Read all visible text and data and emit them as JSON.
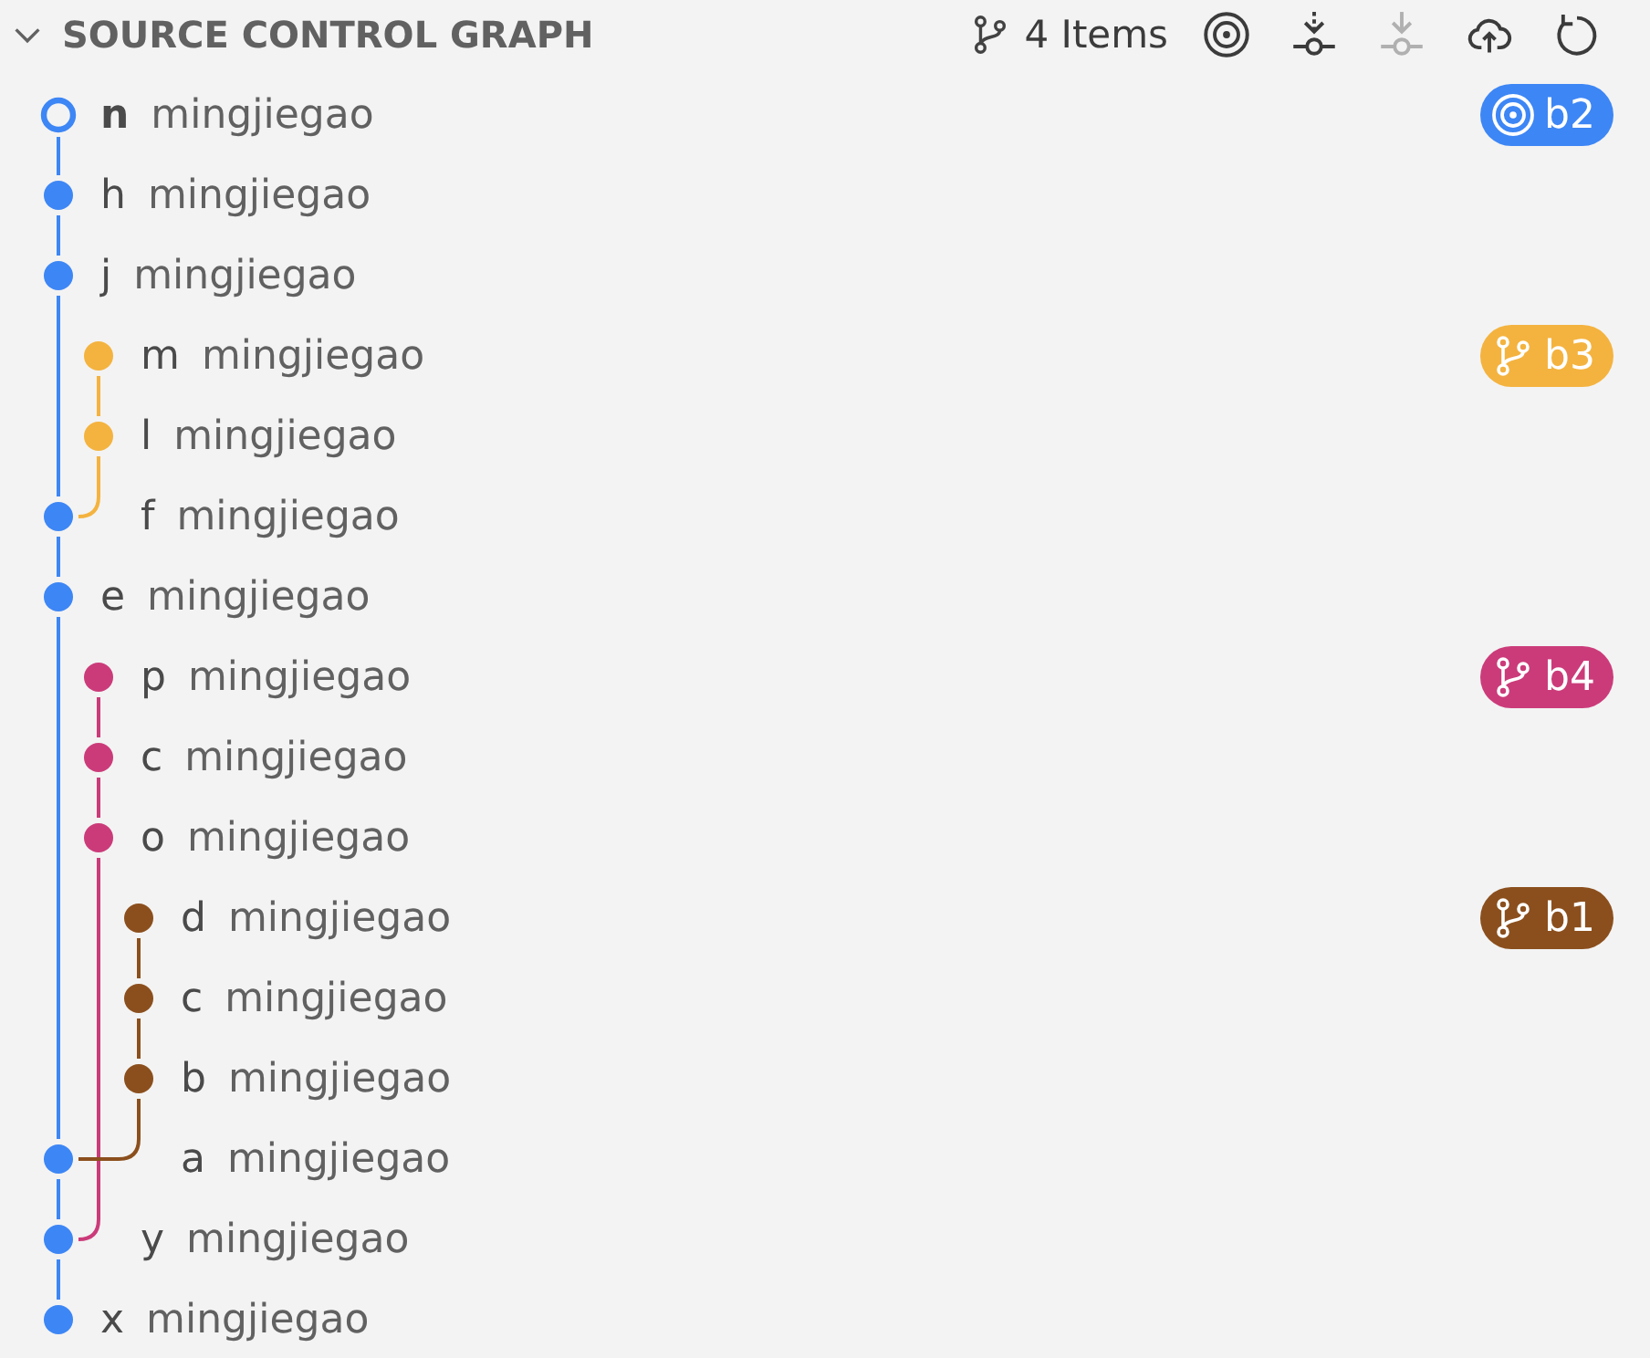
{
  "header": {
    "title": "SOURCE CONTROL GRAPH",
    "expanded": true,
    "count": "4 Items",
    "actions": [
      {
        "kind": "target",
        "disabled": false
      },
      {
        "kind": "fetch",
        "disabled": false
      },
      {
        "kind": "pull",
        "disabled": true
      },
      {
        "kind": "push",
        "disabled": false
      },
      {
        "kind": "refresh",
        "disabled": false
      }
    ]
  },
  "commits": [
    {
      "message": "n",
      "author": "mingjiegao",
      "graph": [
        {
          "kind": "head",
          "color": "#3d86f5"
        }
      ],
      "ref": {
        "label": "b2",
        "kind": "current",
        "color": "#3d86f5"
      }
    },
    {
      "message": "h",
      "author": "mingjiegao",
      "graph": [
        {
          "kind": "node",
          "color": "#3d86f5"
        }
      ]
    },
    {
      "message": "j",
      "author": "mingjiegao",
      "graph": [
        {
          "kind": "node",
          "color": "#3d86f5"
        }
      ]
    },
    {
      "message": "m",
      "author": "mingjiegao",
      "graph": [
        {
          "kind": "line",
          "color": "#3d86f5"
        },
        {
          "kind": "tip",
          "color": "#f4b33f"
        }
      ],
      "ref": {
        "label": "b3",
        "kind": "branch",
        "color": "#f4b33f"
      }
    },
    {
      "message": "l",
      "author": "mingjiegao",
      "graph": [
        {
          "kind": "line",
          "color": "#3d86f5"
        },
        {
          "kind": "node",
          "color": "#f4b33f"
        }
      ]
    },
    {
      "message": "f",
      "author": "mingjiegao",
      "graph": [
        {
          "kind": "node",
          "color": "#3d86f5"
        },
        {
          "kind": "merge",
          "color": "#f4b33f"
        }
      ]
    },
    {
      "message": "e",
      "author": "mingjiegao",
      "graph": [
        {
          "kind": "node",
          "color": "#3d86f5"
        }
      ]
    },
    {
      "message": "p",
      "author": "mingjiegao",
      "graph": [
        {
          "kind": "line",
          "color": "#3d86f5"
        },
        {
          "kind": "tip",
          "color": "#cb3b7a"
        }
      ],
      "ref": {
        "label": "b4",
        "kind": "branch",
        "color": "#cb3b7a"
      }
    },
    {
      "message": "c",
      "author": "mingjiegao",
      "graph": [
        {
          "kind": "line",
          "color": "#3d86f5"
        },
        {
          "kind": "node",
          "color": "#cb3b7a"
        }
      ]
    },
    {
      "message": "o",
      "author": "mingjiegao",
      "graph": [
        {
          "kind": "line",
          "color": "#3d86f5"
        },
        {
          "kind": "node",
          "color": "#cb3b7a"
        }
      ]
    },
    {
      "message": "d",
      "author": "mingjiegao",
      "graph": [
        {
          "kind": "line",
          "color": "#3d86f5"
        },
        {
          "kind": "line",
          "color": "#cb3b7a"
        },
        {
          "kind": "tip",
          "color": "#8b4f1d"
        }
      ],
      "ref": {
        "label": "b1",
        "kind": "branch",
        "color": "#8b4f1d"
      }
    },
    {
      "message": "c",
      "author": "mingjiegao",
      "graph": [
        {
          "kind": "line",
          "color": "#3d86f5"
        },
        {
          "kind": "line",
          "color": "#cb3b7a"
        },
        {
          "kind": "node",
          "color": "#8b4f1d"
        }
      ]
    },
    {
      "message": "b",
      "author": "mingjiegao",
      "graph": [
        {
          "kind": "line",
          "color": "#3d86f5"
        },
        {
          "kind": "line",
          "color": "#cb3b7a"
        },
        {
          "kind": "node",
          "color": "#8b4f1d"
        }
      ]
    },
    {
      "message": "a",
      "author": "mingjiegao",
      "graph": [
        {
          "kind": "node",
          "color": "#3d86f5"
        },
        {
          "kind": "line",
          "color": "#cb3b7a"
        },
        {
          "kind": "merge",
          "color": "#8b4f1d"
        }
      ]
    },
    {
      "message": "y",
      "author": "mingjiegao",
      "graph": [
        {
          "kind": "node",
          "color": "#3d86f5"
        },
        {
          "kind": "merge",
          "color": "#cb3b7a"
        }
      ]
    },
    {
      "message": "x",
      "author": "mingjiegao",
      "graph": [
        {
          "kind": "end",
          "color": "#3d86f5"
        }
      ]
    }
  ]
}
